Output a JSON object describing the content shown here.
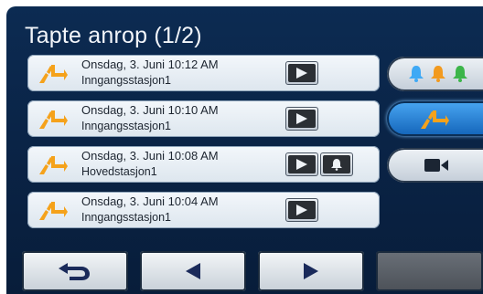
{
  "title": "Tapte anrop (1/2)",
  "calls": [
    {
      "date": "Onsdag, 3. Juni 10:12 AM",
      "station": "Inngangsstasjon1",
      "has_bell": false
    },
    {
      "date": "Onsdag, 3. Juni 10:10 AM",
      "station": "Inngangsstasjon1",
      "has_bell": false
    },
    {
      "date": "Onsdag, 3. Juni 10:08 AM",
      "station": "Hovedstasjon1",
      "has_bell": true
    },
    {
      "date": "Onsdag, 3. Juni 10:04 AM",
      "station": "Inngangsstasjon1",
      "has_bell": false
    }
  ],
  "side_buttons": [
    {
      "name": "bell-filter-button",
      "icon": "tricolor-bells-icon",
      "active": false
    },
    {
      "name": "missed-call-filter-button",
      "icon": "missed-call-icon",
      "active": true
    },
    {
      "name": "video-button",
      "icon": "video-camera-icon",
      "active": false
    }
  ],
  "bottom_buttons": [
    {
      "name": "back-button",
      "icon": "return-arrow-icon"
    },
    {
      "name": "previous-page-button",
      "icon": "triangle-left-icon"
    },
    {
      "name": "next-page-button",
      "icon": "triangle-right-icon"
    },
    {
      "name": "blank-button",
      "icon": "none",
      "disabled": true
    }
  ],
  "colors": {
    "accent": "#f5a21b",
    "active": "#2b86db",
    "background": "#0b2649",
    "bell_blue": "#3fa9f5",
    "bell_orange": "#f29a1f",
    "bell_green": "#3cb54a"
  }
}
